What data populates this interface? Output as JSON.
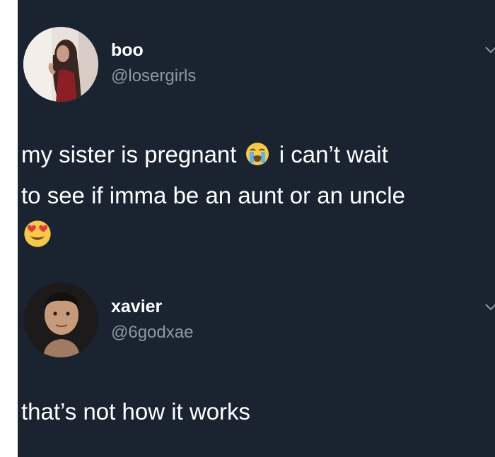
{
  "tweets": [
    {
      "display_name": "boo",
      "handle": "@losergirls",
      "text_line1_a": "my sister is pregnant",
      "text_line1_b": "i can’t wait",
      "text_line2": "to see if imma be an aunt or an uncle",
      "emojis": [
        "loudly-crying-face",
        "heart-eyes-face"
      ]
    },
    {
      "display_name": "xavier",
      "handle": "@6godxae",
      "text": "that’s not how it works"
    }
  ],
  "colors": {
    "background": "#1a2431",
    "name": "#ffffff",
    "handle": "#8a99a8",
    "text": "#ffffff"
  }
}
